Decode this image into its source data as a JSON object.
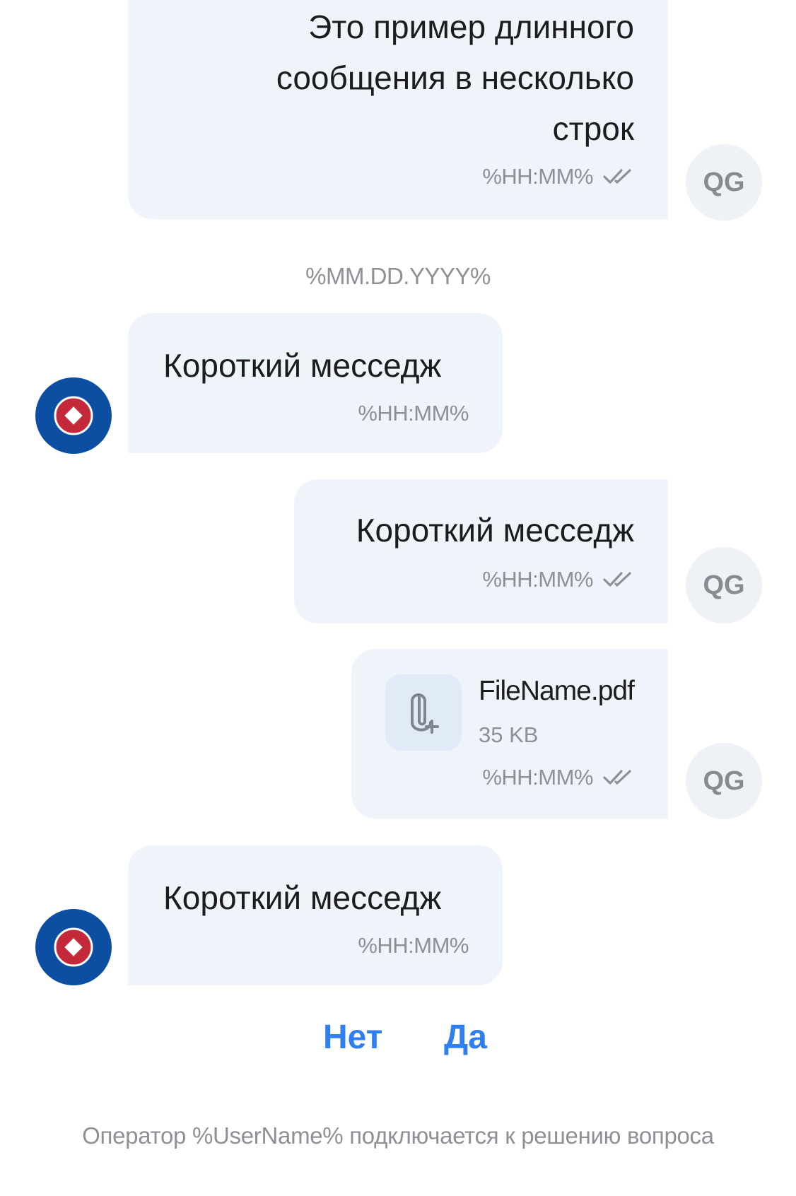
{
  "messages": [
    {
      "text_lines": [
        "Это пример длинного",
        "сообщения в несколько",
        "строк"
      ],
      "time": "%HH:MM%",
      "avatar": "QG"
    },
    {
      "text": "Короткий месседж",
      "time": "%HH:MM%"
    },
    {
      "text": "Короткий месседж",
      "time": "%HH:MM%",
      "avatar": "QG"
    },
    {
      "file_name": "FileName.pdf",
      "file_size": "35 KB",
      "time": "%HH:MM%",
      "avatar": "QG"
    },
    {
      "text": "Короткий месседж",
      "time": "%HH:MM%"
    }
  ],
  "date_separator": "%MM.DD.YYYY%",
  "quick_replies": {
    "no": "Нет",
    "yes": "Да"
  },
  "status": "Оператор %UserName% подключается к решению вопроса",
  "icons": {
    "read_status": "double-check-icon",
    "attachment": "paperclip-add-icon",
    "bot_avatar": "bot-logo-icon"
  },
  "colors": {
    "bubble": "#eff4fb",
    "accent": "#2f7ff0",
    "bot_avatar_bg": "#0b4ea2",
    "bot_avatar_inner": "#c4293a"
  }
}
